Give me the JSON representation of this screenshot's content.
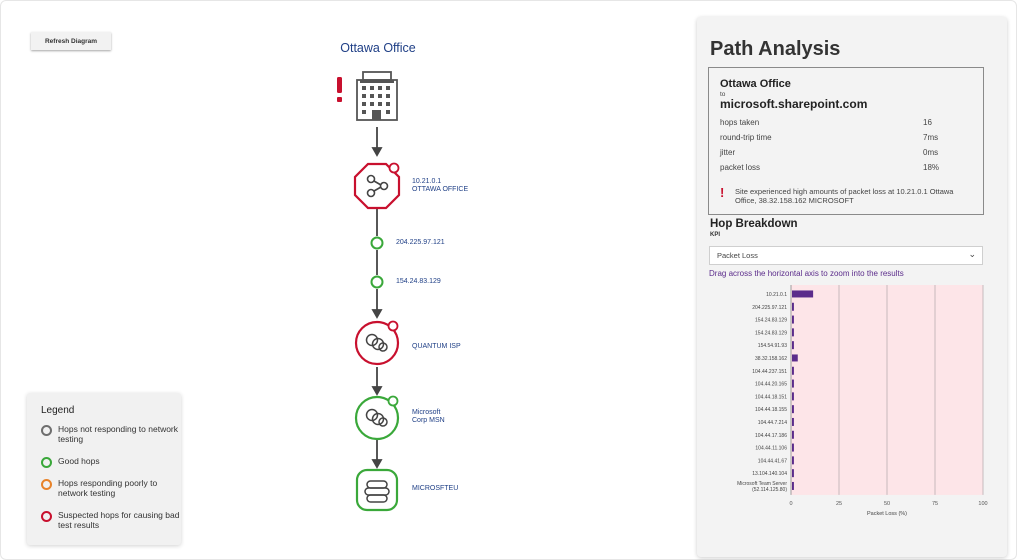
{
  "toolbar": {
    "refresh_label": "Refresh Diagram"
  },
  "diagram": {
    "title": "Ottawa Office",
    "hops": [
      {
        "ip": "10.21.0.1",
        "name": "OTTAWA OFFICE"
      },
      {
        "ip": "204.225.97.121",
        "name": ""
      },
      {
        "ip": "154.24.83.129",
        "name": ""
      },
      {
        "ip": "QUANTUM ISP",
        "name": ""
      },
      {
        "ip": "Microsoft",
        "name": "Corp MSN"
      },
      {
        "ip": "MICROSFTEU",
        "name": ""
      }
    ]
  },
  "legend": {
    "title": "Legend",
    "items": [
      {
        "label": "Hops not responding to network testing",
        "color": "#6e6e6e"
      },
      {
        "label": "Good hops",
        "color": "#3aa83a"
      },
      {
        "label": "Hops responding poorly to network testing",
        "color": "#e8832a"
      },
      {
        "label": "Suspected hops for causing bad test results",
        "color": "#c8102e"
      }
    ]
  },
  "panel": {
    "title": "Path Analysis",
    "summary": {
      "from": "Ottawa Office",
      "to_label": "to",
      "destination": "microsoft.sharepoint.com",
      "stats": [
        {
          "label": "hops taken",
          "value": "16"
        },
        {
          "label": "round-trip time",
          "value": "7ms"
        },
        {
          "label": "jitter",
          "value": "0ms"
        },
        {
          "label": "packet loss",
          "value": "18%"
        }
      ],
      "warning": "Site experienced high amounts of packet loss at 10.21.0.1 Ottawa Office, 38.32.158.162 MICROSOFT"
    },
    "hop_breakdown": {
      "title": "Hop Breakdown",
      "kpi_label": "KPI",
      "selected": "Packet Loss",
      "zoom_hint": "Drag across the horizontal axis to zoom into the results"
    }
  },
  "colors": {
    "accent": "#5b2c8b",
    "alert": "#c8102e",
    "good": "#3aa83a",
    "link": "#1f3f86"
  },
  "chart_data": {
    "type": "bar",
    "orientation": "horizontal",
    "categories": [
      "10.21.0.1",
      "204.225.97.121",
      "154.24.83.129",
      "154.24.83.129",
      "154.54.91.93",
      "38.32.158.162",
      "104.44.237.151",
      "104.44.20.165",
      "104.44.18.151",
      "104.44.18.155",
      "104.44.7.214",
      "104.44.17.186",
      "104.44.11.106",
      "104.44.41.67",
      "13.104.140.104",
      "Microsoft Team Server (52.114.125.80)"
    ],
    "values": [
      11,
      1,
      1,
      1,
      1,
      3,
      1,
      1,
      1,
      1,
      1,
      1,
      1,
      1,
      1,
      1
    ],
    "xlabel": "Packet Loss (%)",
    "ylabel": "",
    "xlim": [
      0,
      100
    ],
    "xticks": [
      "0",
      "25",
      "50",
      "75",
      "100"
    ],
    "highlight_color": "#fde5e8",
    "bar_color": "#5b2c8b",
    "grid": true
  }
}
